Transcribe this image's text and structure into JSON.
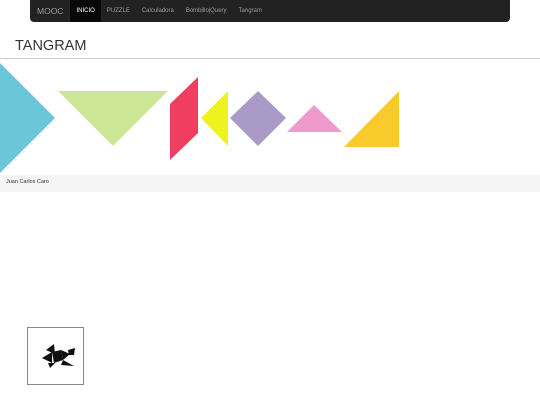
{
  "navbar": {
    "brand": "MOOC",
    "items": [
      {
        "label": "INICIO",
        "active": true
      },
      {
        "label": "PUZZLE",
        "active": false
      },
      {
        "label": "Calculadora",
        "active": false
      },
      {
        "label": "BombillojQuery",
        "active": false
      },
      {
        "label": "Tangram",
        "active": false
      }
    ]
  },
  "page": {
    "title": "TANGRAM"
  },
  "footer": {
    "author": "Juan Carlos Caro"
  },
  "colors": {
    "navbar_bg": "#222222",
    "piece_cyan": "#6cc6d9",
    "piece_green": "#cce897",
    "piece_red": "#ef3e5f",
    "piece_yellow": "#eef21f",
    "piece_purple": "#a99ac8",
    "piece_pink": "#ee9bcc",
    "piece_orange": "#f8ca2b",
    "silhouette": "#111111"
  }
}
